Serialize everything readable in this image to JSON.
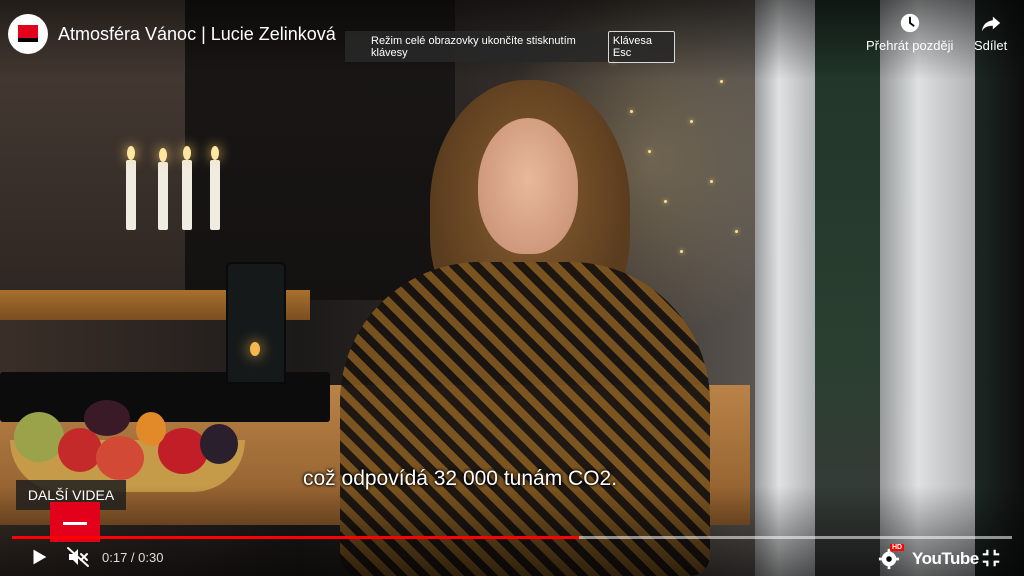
{
  "video": {
    "title": "Atmosféra Vánoc | Lucie Zelinková",
    "subtitle": "což odpovídá 32 000 tunám CO2."
  },
  "fullscreen_toast": {
    "message": "Režim celé obrazovky ukončíte stisknutím klávesy",
    "key_label": "Klávesa Esc"
  },
  "top_actions": {
    "watch_later_label": "Přehrát později",
    "share_label": "Sdílet"
  },
  "end_screen": {
    "more_videos_label": "DALŠÍ VIDEA"
  },
  "player": {
    "current_time": "0:17",
    "duration": "0:30",
    "time_display": "0:17 / 0:30",
    "progress_fraction": 0.567,
    "buffered_fraction": 1.0,
    "quality_badge": "HD",
    "brand_label": "YouTube",
    "muted": true
  },
  "colors": {
    "progress": "#ff0000",
    "brand_red": "#e2001a"
  },
  "icons": [
    "play-icon",
    "mute-icon",
    "settings-icon",
    "exit-fullscreen-icon",
    "clock-icon",
    "share-icon"
  ]
}
